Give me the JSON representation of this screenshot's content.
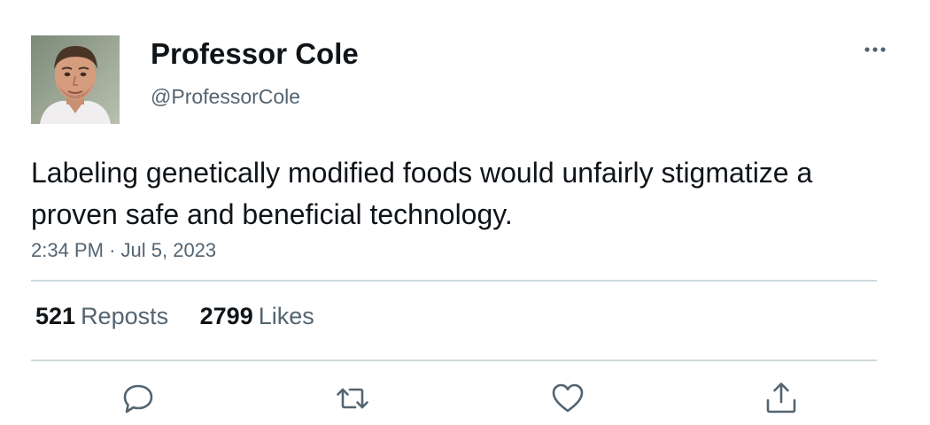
{
  "tweet": {
    "author_name": "Professor Cole",
    "author_handle": "@ProfessorCole",
    "text": "Labeling genetically modified foods would unfairly stigmatize a proven safe and beneficial technology.",
    "time": "2:34 PM",
    "separator": "·",
    "date": "Jul 5, 2023",
    "reposts_count": "521",
    "reposts_label": "Reposts",
    "likes_count": "2799",
    "likes_label": "Likes"
  },
  "icons": {
    "more": "more-horizontal-icon",
    "reply": "reply-icon",
    "repost": "repost-icon",
    "like": "heart-icon",
    "share": "share-icon"
  },
  "colors": {
    "text_primary": "#0f1419",
    "text_secondary": "#536471",
    "divider": "#cfd9de"
  }
}
